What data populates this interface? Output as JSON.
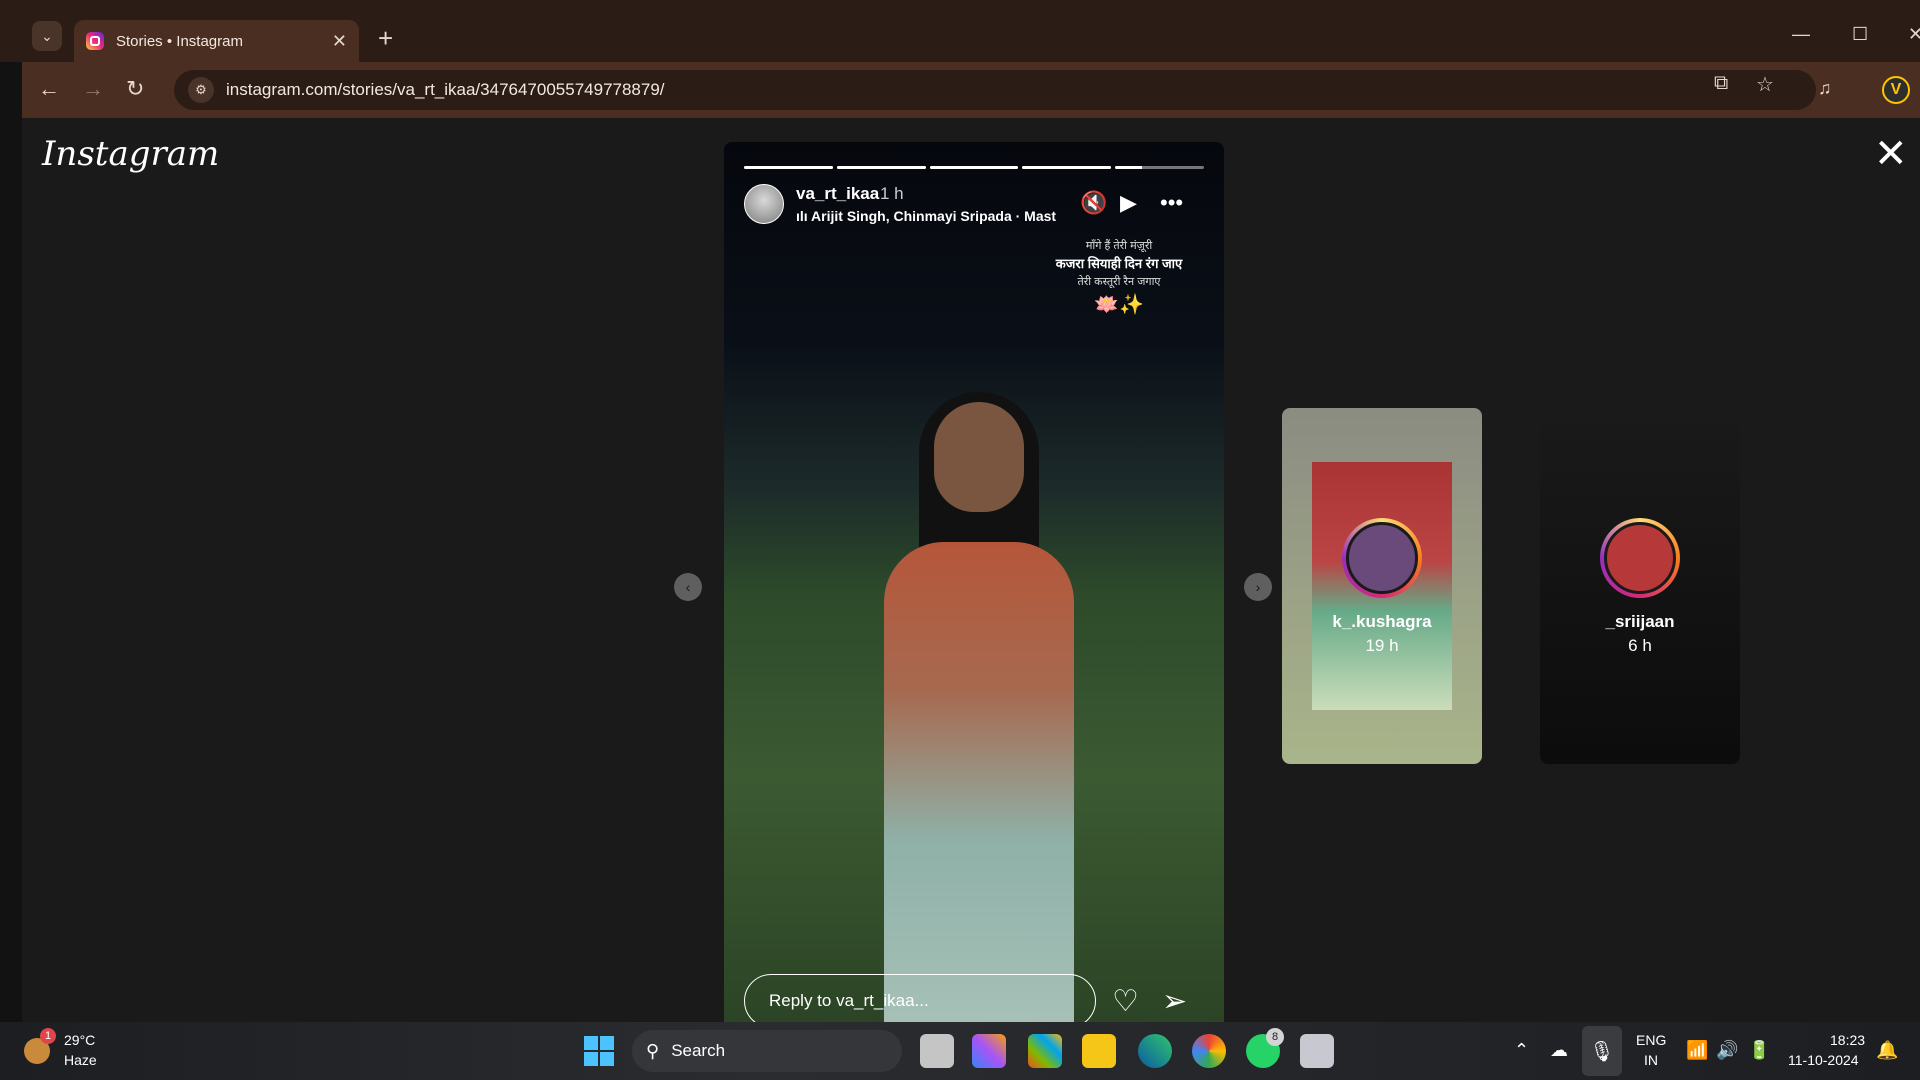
{
  "browser": {
    "tab_title": "Stories • Instagram",
    "url": "instagram.com/stories/va_rt_ikaa/3476470055749778879/",
    "profile_initial": "V"
  },
  "page": {
    "logo": "Instagram",
    "close_glyph": "✕"
  },
  "story": {
    "username": "va_rt_ikaa",
    "time": "1 h",
    "music": "Arijit Singh, Chinmayi Sripada · Mast",
    "lyrics": [
      "माँगे हैं तेरी मंज़ूरी",
      "कजरा सियाही दिन रंग जाए",
      "तेरी कस्तूरी रैन जगाए"
    ],
    "emojis": "🪷✨",
    "reply_placeholder": "Reply to va_rt_ikaa...",
    "progress": [
      1,
      1,
      1,
      1,
      0.3
    ]
  },
  "next_stories": [
    {
      "username": "k_.kushagra",
      "time": "19 h"
    },
    {
      "username": "_sriijaan",
      "time": "6 h"
    }
  ],
  "taskbar": {
    "weather_badge": "1",
    "temperature": "29°C",
    "condition": "Haze",
    "search_label": "Search",
    "whatsapp_badge": "8",
    "lang": "ENG",
    "region": "IN",
    "time": "18:23",
    "date": "11-10-2024"
  },
  "colors": {
    "chrome": "#2b1c16",
    "toolbar": "#4a2e22",
    "page_bg": "#1a1a1a",
    "win_accent": "#4cc2ff"
  }
}
